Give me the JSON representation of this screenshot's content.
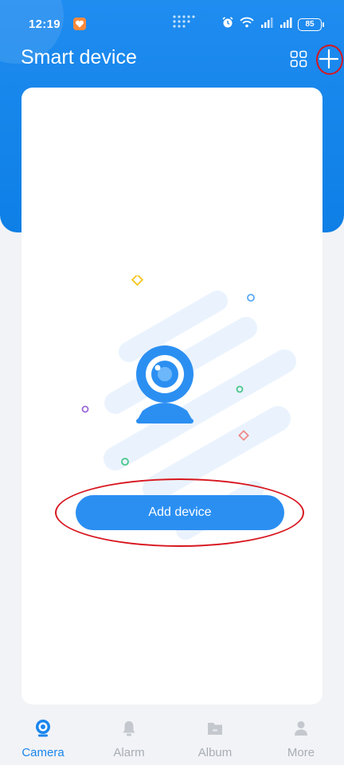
{
  "status_bar": {
    "time": "12:19",
    "battery": "85"
  },
  "header": {
    "title": "Smart device"
  },
  "main": {
    "add_device_label": "Add device"
  },
  "bottom_nav": {
    "tabs": [
      {
        "label": "Camera",
        "icon": "camera-icon",
        "active": true
      },
      {
        "label": "Alarm",
        "icon": "bell-icon",
        "active": false
      },
      {
        "label": "Album",
        "icon": "folder-icon",
        "active": false
      },
      {
        "label": "More",
        "icon": "user-icon",
        "active": false
      }
    ]
  },
  "colors": {
    "primary": "#1a86ee",
    "header_blue": "#1585ec",
    "button_blue": "#2b8ff2",
    "inactive_gray": "#a8adb5",
    "annotation_red": "#d8161f"
  }
}
